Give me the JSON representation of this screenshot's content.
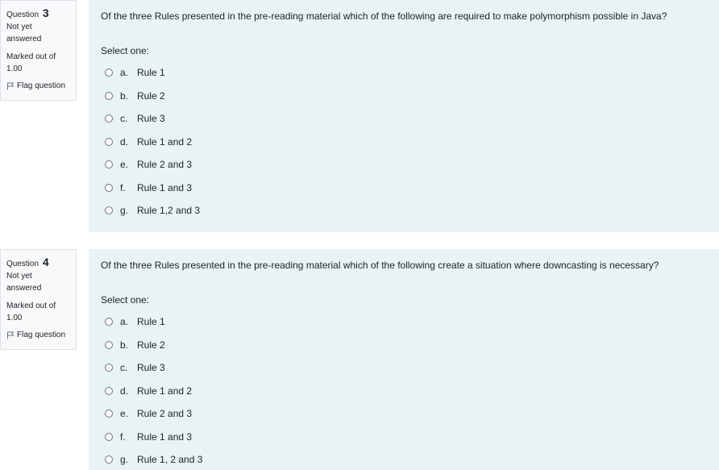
{
  "questions": [
    {
      "label": "Question",
      "number": "3",
      "state": "Not yet answered",
      "grade": "Marked out of 1.00",
      "flag": "Flag question",
      "text": "Of the three Rules presented in the pre-reading material which of the following are required to make polymorphism possible in Java?",
      "prompt": "Select one:",
      "options": [
        {
          "letter": "a.",
          "label": "Rule 1"
        },
        {
          "letter": "b.",
          "label": "Rule 2"
        },
        {
          "letter": "c.",
          "label": "Rule 3"
        },
        {
          "letter": "d.",
          "label": "Rule 1 and 2"
        },
        {
          "letter": "e.",
          "label": "Rule 2 and 3"
        },
        {
          "letter": "f.",
          "label": "Rule 1 and 3"
        },
        {
          "letter": "g.",
          "label": "Rule 1,2 and 3"
        }
      ]
    },
    {
      "label": "Question",
      "number": "4",
      "state": "Not yet answered",
      "grade": "Marked out of 1.00",
      "flag": "Flag question",
      "text": "Of the three Rules presented in the pre-reading material which of the following create a situation where downcasting is necessary?",
      "prompt": "Select one:",
      "options": [
        {
          "letter": "a.",
          "label": "Rule 1"
        },
        {
          "letter": "b.",
          "label": "Rule 2"
        },
        {
          "letter": "c.",
          "label": "Rule 3"
        },
        {
          "letter": "d.",
          "label": "Rule 1 and 2"
        },
        {
          "letter": "e.",
          "label": "Rule 2 and 3"
        },
        {
          "letter": "f.",
          "label": "Rule 1 and 3"
        },
        {
          "letter": "g.",
          "label": "Rule 1, 2 and 3"
        }
      ]
    }
  ],
  "icons": {
    "flag": "flag-icon",
    "radio": "radio-unchecked-icon"
  },
  "colors": {
    "info_bg": "#f8f9fa",
    "content_bg": "#e7f3f5",
    "border": "#dee2e6"
  }
}
